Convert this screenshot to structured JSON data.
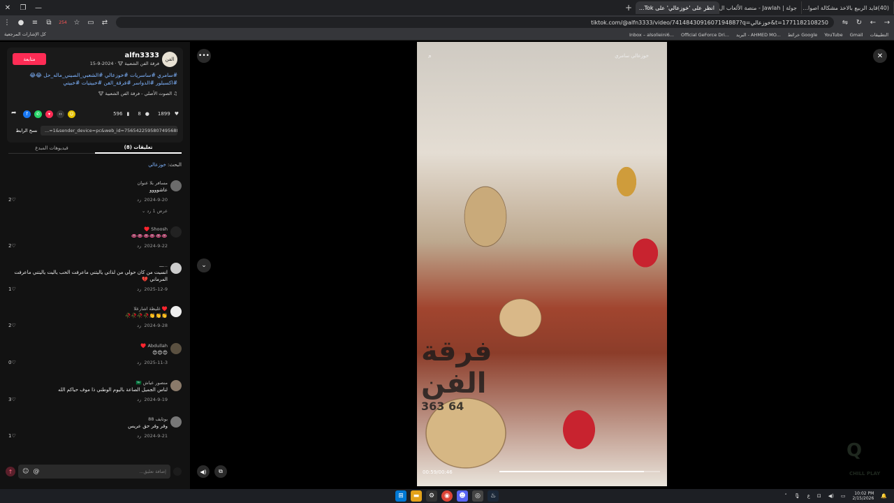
{
  "browser": {
    "tabs": [
      {
        "label": "(40)قايد الربيع بالاخذ مشكالة اصوا..."
      },
      {
        "label": "جولة | Jawlah - منصة الألعاب ال..."
      },
      {
        "label": "انظر على 'خوزعالي' على Tok...",
        "active": true
      }
    ],
    "url": "tiktok.com/@alfn3333/video/7414843091607194887?q=خوزعالي&t=1771182108250",
    "extension_badge": "254",
    "bookmarks": [
      "التطبيقات",
      "Gmail",
      "YouTube",
      "خرائط Google",
      "البريد - AHMED MO...",
      "Official GeForce Dri...",
      "Inbox – alsolieini6..."
    ],
    "bookmarks_left": "كل الإشارات المرجعية"
  },
  "post": {
    "follow_label": "متابعة",
    "username": "alfn3333",
    "subtitle": "فرقة الفن الشعبية 🐮 · 2024-9-15",
    "avatar_text": "الفن",
    "tags": "#سامري #ساسريات #خوزعالي #الشعبي_الصيني_ماله_حل 😂😂 #اكسبلور #الدواسر #فرقة_الفن #خبيتيات #خبيتي",
    "music": "♫ الصوت الأصلي - فرقة الفن الشعبية 🐮",
    "likes": "1899",
    "comments_count": "8",
    "saves": "596",
    "link": "...=1&sender_device=pc&web_id=7565422595807495688",
    "copy_label": "نسخ الرابط"
  },
  "tabs": {
    "comments": "تعليقات (8)",
    "creator_videos": "فيديوهات المبدع"
  },
  "search": {
    "label": "البحث:",
    "query": "خوزعالي"
  },
  "comments": [
    {
      "name": "مسافر بلا عنوان",
      "text": "عاشوووو",
      "date": "2024-9-20",
      "reply": "رد",
      "likes": "2",
      "replies_label": "عرض 1 رد"
    },
    {
      "name": "Shoosh ♥️",
      "text": "👄👄👄👄👄👄",
      "date": "2024-9-22",
      "reply": "رد",
      "likes": "2"
    },
    {
      "name": "...ـــ",
      "text": "انسيت من كان حولي من لذاتي ياليتني ماعرفت الحب ياليت ياليتني ماعرفت المرماني 💔",
      "date": "2025-12-9",
      "reply": "رد",
      "likes": "1"
    },
    {
      "name": "♥️ غليظة اشارعلا",
      "text": "👏👏👏🥀🥀🥀🥀",
      "date": "2024-9-28",
      "reply": "رد",
      "likes": "2"
    },
    {
      "name": "Abdullah ♥️",
      "text": "😍😍😍",
      "date": "2025-11-3",
      "reply": "رد",
      "likes": "0"
    },
    {
      "name": "منصور عياش 🇸🇦",
      "text": "لناس الجميل الصاعة باليوم الوطني ذا موف حياكم الله",
      "date": "2024-9-19",
      "reply": "رد",
      "likes": "3"
    },
    {
      "name": "بوتايف 88",
      "text": "وفر وفر حق عريس",
      "date": "2024-9-21",
      "reply": "رد",
      "likes": "1"
    }
  ],
  "composer": {
    "placeholder": "إضافة تعليق...",
    "emoji": "☺",
    "mention": "@"
  },
  "video": {
    "search_query": "خوزعالي سامري",
    "caption_text": "فرقة الفن",
    "caption_number": "64 363",
    "time": "00:59/00:46",
    "progress": 0.9
  },
  "taskbar": {
    "time": "10:02 PM",
    "date": "2/15/2026",
    "lang": "ع"
  },
  "watermark": {
    "main": "Q",
    "sub": "CHILL PLAY"
  },
  "colors": {
    "accent": "#fe2c55",
    "link": "#7fb4ff"
  }
}
